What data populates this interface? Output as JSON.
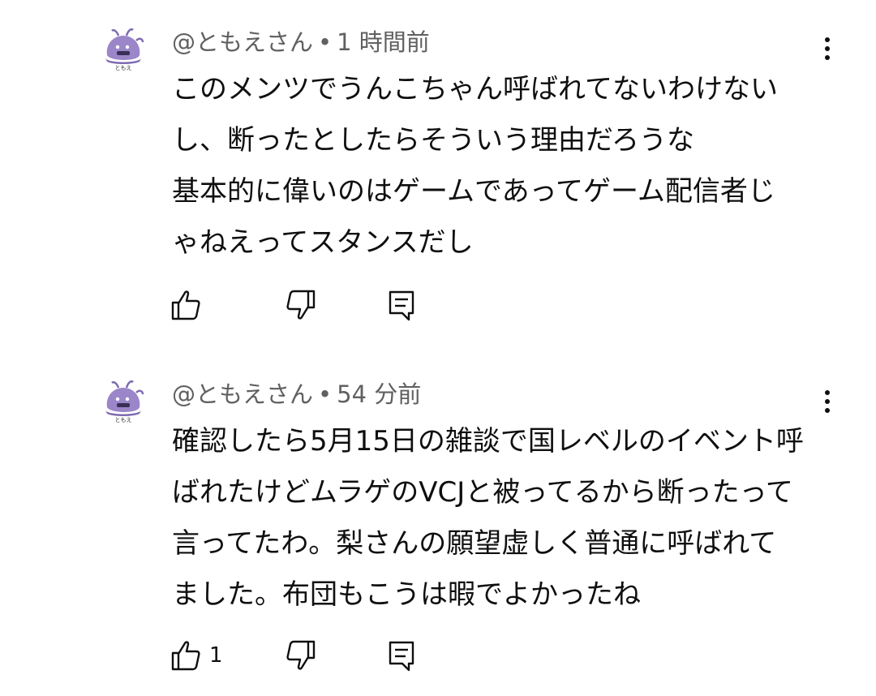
{
  "comments": [
    {
      "author": "@ともえさん",
      "separator": "•",
      "time": "1 時間前",
      "lines": [
        "このメンツでうんこちゃん呼ばれてないわけない",
        "し、断ったとしたらそういう理由だろうな",
        "基本的に偉いのはゲームであってゲーム配信者じ",
        "ゃねえってスタンスだし"
      ],
      "like_count": "",
      "avatar_caption": "ともえ"
    },
    {
      "author": "@ともえさん",
      "separator": "•",
      "time": "54 分前",
      "lines": [
        "確認したら5月15日の雑談で国レベルのイベント呼",
        "ばれたけどムラゲのVCJと被ってるから断ったって",
        "言ってたわ。梨さんの願望虚しく普通に呼ばれて",
        "ました。布団もこうは暇でよかったね"
      ],
      "like_count": "1",
      "avatar_caption": "ともえ"
    }
  ],
  "icons": {
    "like": "thumb-up-icon",
    "dislike": "thumb-down-icon",
    "reply": "reply-icon",
    "more": "more-vert-icon"
  },
  "colors": {
    "text": "#0f0f0f",
    "meta": "#606060",
    "avatar_purple": "#9a86c8"
  }
}
